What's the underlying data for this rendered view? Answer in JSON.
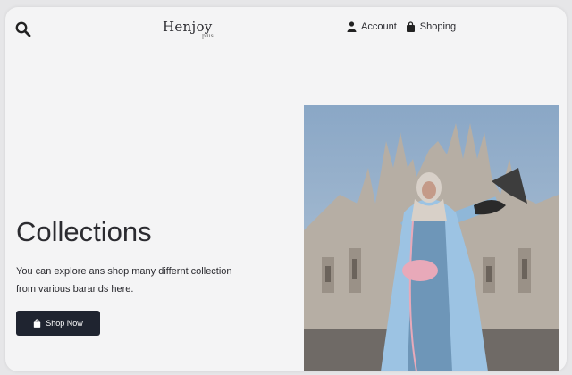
{
  "header": {
    "search_icon": "search-icon",
    "logo": {
      "main": "Henjoy",
      "sub": "plus"
    },
    "nav": [
      {
        "label": "Account",
        "icon": "user-icon"
      },
      {
        "label": "Shoping",
        "icon": "bag-icon"
      }
    ]
  },
  "hero": {
    "title": "Collections",
    "description": "You can explore ans shop many differnt collection from various barands here.",
    "button": {
      "label": "Shop Now",
      "icon": "bag-icon"
    }
  },
  "colors": {
    "accent": "#1f2430",
    "background": "#f4f4f5",
    "text": "#2b2b30"
  }
}
